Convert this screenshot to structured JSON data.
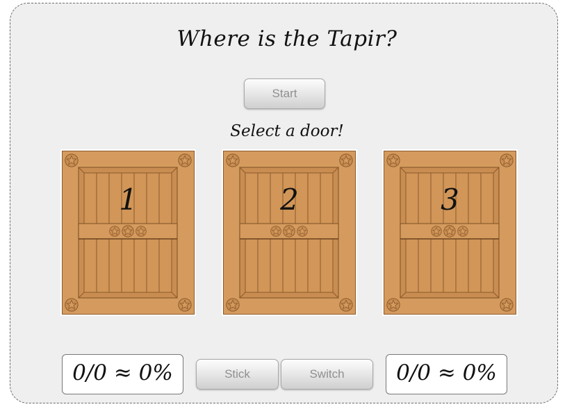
{
  "title": "Where is the Tapir?",
  "start_label": "Start",
  "prompt": "Select a door!",
  "doors": [
    {
      "label": "1"
    },
    {
      "label": "2"
    },
    {
      "label": "3"
    }
  ],
  "stick_label": "Stick",
  "switch_label": "Switch",
  "stick_score": "0/0 ≈ 0%",
  "switch_score": "0/0 ≈ 0%",
  "colors": {
    "door_face": "#d59b5e",
    "door_panel": "#c98d52",
    "door_edge": "#8a5a2b",
    "background": "#efefef"
  }
}
